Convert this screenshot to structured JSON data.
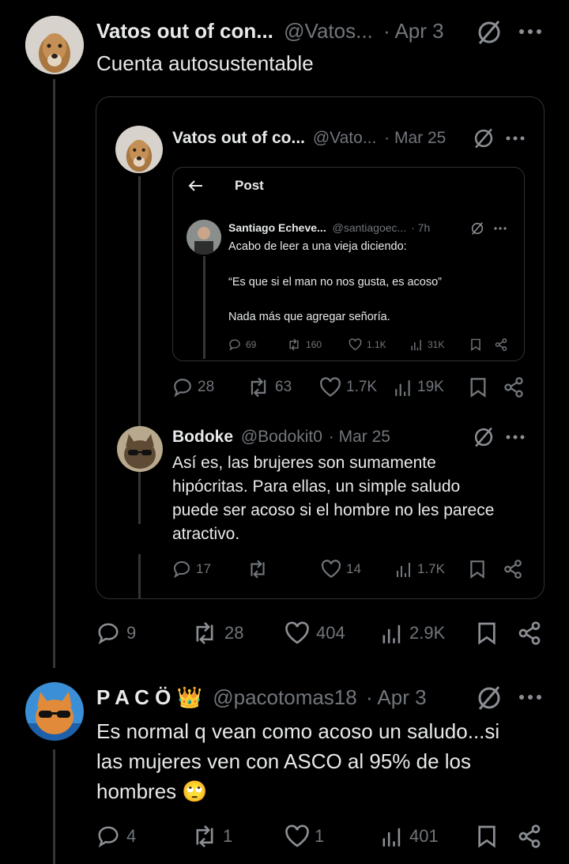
{
  "tweet1": {
    "name": "Vatos out of con...",
    "handle": "@Vatos...",
    "date": "· Apr 3",
    "text": "Cuenta autosustentable",
    "stats": {
      "replies": "9",
      "reposts": "28",
      "likes": "404",
      "views": "2.9K"
    }
  },
  "quote": {
    "name": "Vatos out of co...",
    "handle": "@Vato...",
    "date": "· Mar 25",
    "stats": {
      "replies": "28",
      "reposts": "63",
      "likes": "1.7K",
      "views": "19K"
    },
    "screenshot": {
      "header_title": "Post",
      "name": "Santiago Echeve...",
      "handle": "@santiagoec...",
      "date": "· 7h",
      "line1": "Acabo de leer a una vieja diciendo:",
      "line2": "“Es que si el man no nos gusta, es acoso”",
      "line3": "Nada más que agregar señoría.",
      "stats": {
        "replies": "69",
        "reposts": "160",
        "likes": "1.1K",
        "views": "31K"
      }
    },
    "reply": {
      "name": "Bodoke",
      "handle": "@Bodokit0",
      "date": "· Mar 25",
      "lines": [
        "Así es, las brujeres son sumamente",
        "hipócritas. Para ellas, un simple saludo",
        "puede ser acoso si el hombre no les parece",
        "atractivo."
      ],
      "stats": {
        "replies": "17",
        "reposts": "",
        "likes": "14",
        "views": "1.7K"
      }
    }
  },
  "tweet2": {
    "name": "P A C Ö",
    "name_emoji": "👑",
    "handle": "@pacotomas18",
    "date": "· Apr 3",
    "lines": [
      "Es normal q vean como acoso un saludo...si",
      "las mujeres ven con ASCO al 95% de los",
      "hombres"
    ],
    "emoji": "🙄",
    "stats": {
      "replies": "4",
      "reposts": "1",
      "likes": "1",
      "views": "401"
    }
  },
  "colors": {
    "background": "#000000",
    "text": "#e7e9ea",
    "muted": "#71767b",
    "border": "#2f3336"
  }
}
